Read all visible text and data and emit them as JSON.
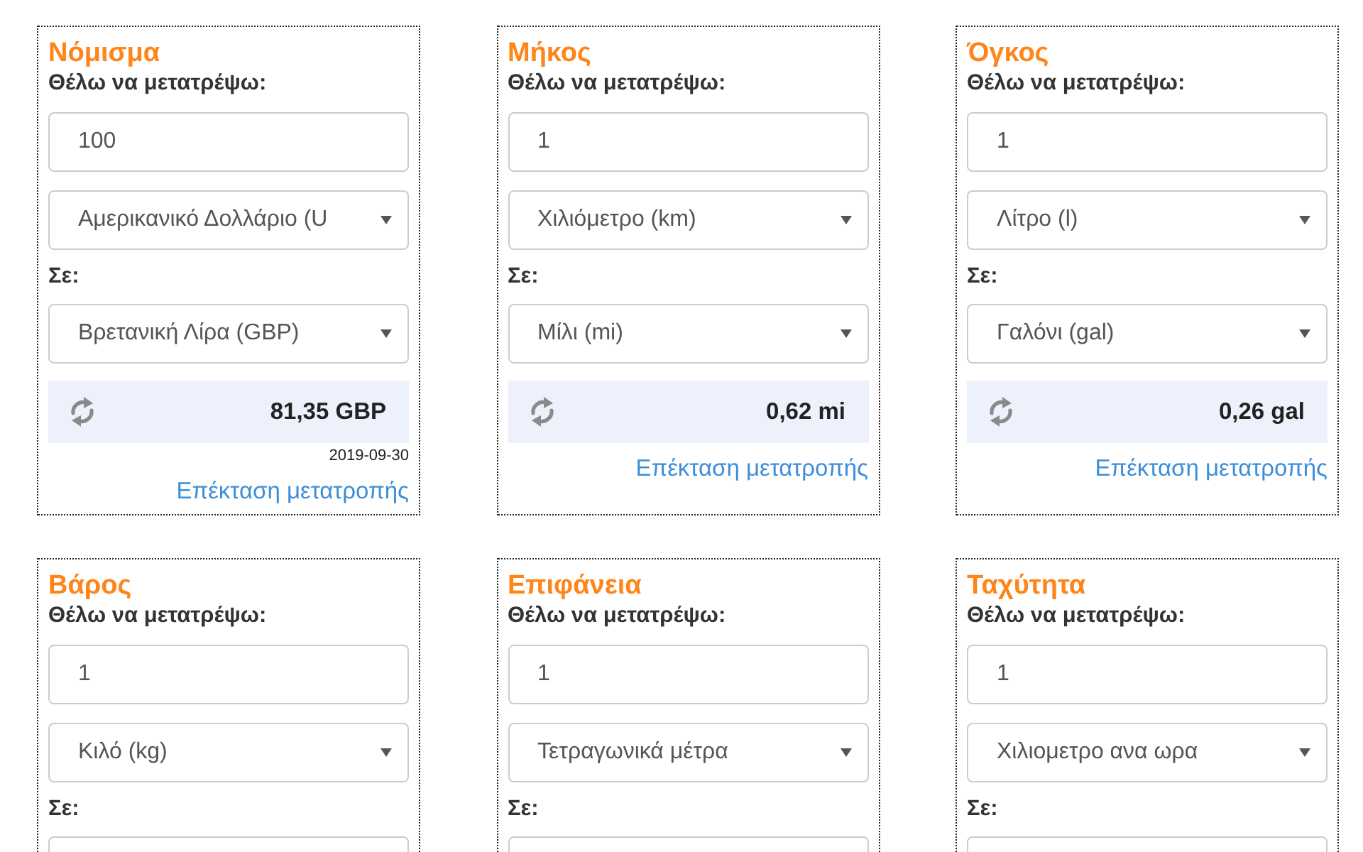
{
  "converters": [
    {
      "title": "Νόμισμα",
      "from_label": "Θέλω να μετατρέψω:",
      "amount": "100",
      "from_unit": "Αμερικανικό Δολλάριο (U",
      "to_label": "Σε:",
      "to_unit": "Βρετανική Λίρα (GBP)",
      "result": "81,35 GBP",
      "date": "2019-09-30",
      "link": "Επέκταση μετατροπής"
    },
    {
      "title": "Μήκος",
      "from_label": "Θέλω να μετατρέψω:",
      "amount": "1",
      "from_unit": "Χιλιόμετρο (km)",
      "to_label": "Σε:",
      "to_unit": "Μίλι (mi)",
      "result": "0,62 mi",
      "link": "Επέκταση μετατροπής"
    },
    {
      "title": "Όγκος",
      "from_label": "Θέλω να μετατρέψω:",
      "amount": "1",
      "from_unit": "Λίτρο (l)",
      "to_label": "Σε:",
      "to_unit": "Γαλόνι (gal)",
      "result": "0,26 gal",
      "link": "Επέκταση μετατροπής"
    },
    {
      "title": "Βάρος",
      "from_label": "Θέλω να μετατρέψω:",
      "amount": "1",
      "from_unit": "Κιλό (kg)",
      "to_label": "Σε:"
    },
    {
      "title": "Επιφάνεια",
      "from_label": "Θέλω να μετατρέψω:",
      "amount": "1",
      "from_unit": "Τετραγωνικά μέτρα",
      "to_label": "Σε:"
    },
    {
      "title": "Ταχύτητα",
      "from_label": "Θέλω να μετατρέψω:",
      "amount": "1",
      "from_unit": "Χιλιομετρο ανα ωρα",
      "to_label": "Σε:"
    }
  ]
}
